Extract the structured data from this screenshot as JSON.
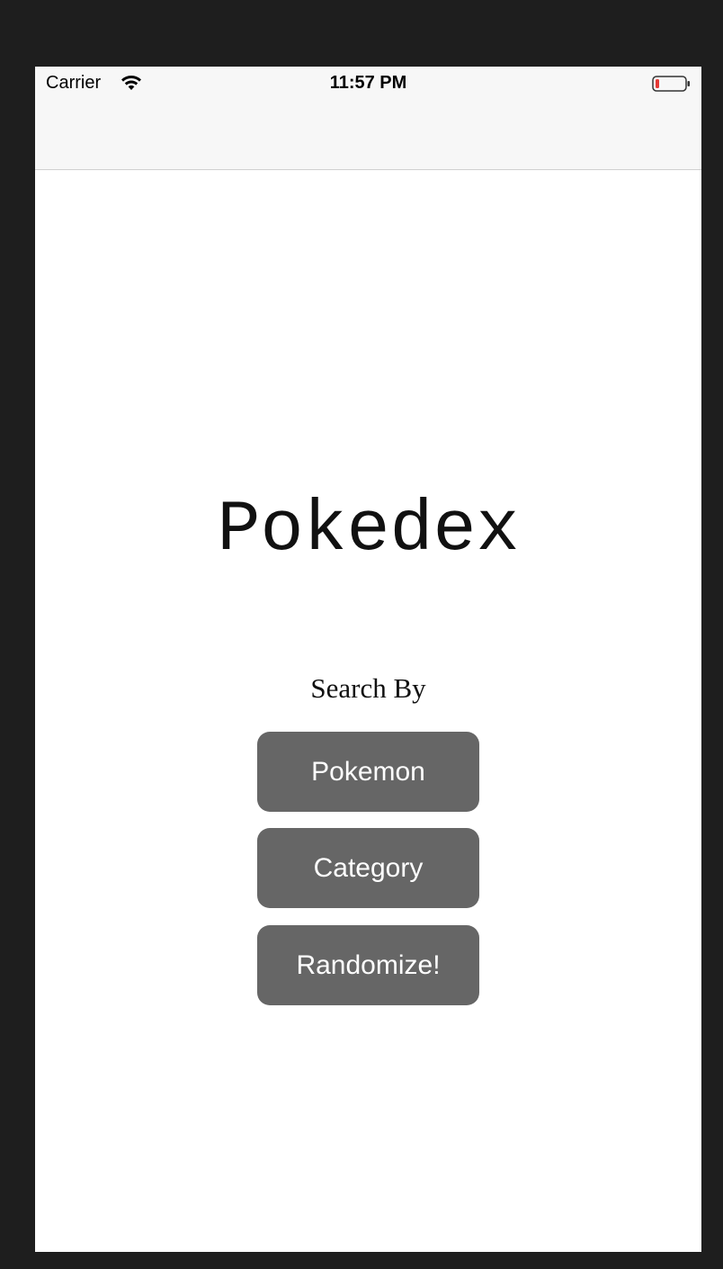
{
  "status_bar": {
    "carrier": "Carrier",
    "time": "11:57 PM",
    "battery_color": "#e53935"
  },
  "main": {
    "title": "Pokedex",
    "subtitle": "Search By",
    "buttons": [
      {
        "label": "Pokemon"
      },
      {
        "label": "Category"
      },
      {
        "label": "Randomize!"
      }
    ]
  },
  "colors": {
    "button_bg": "#666666",
    "button_text": "#ffffff",
    "navbar_bg": "#f7f7f7",
    "background": "#1e1e1e"
  }
}
